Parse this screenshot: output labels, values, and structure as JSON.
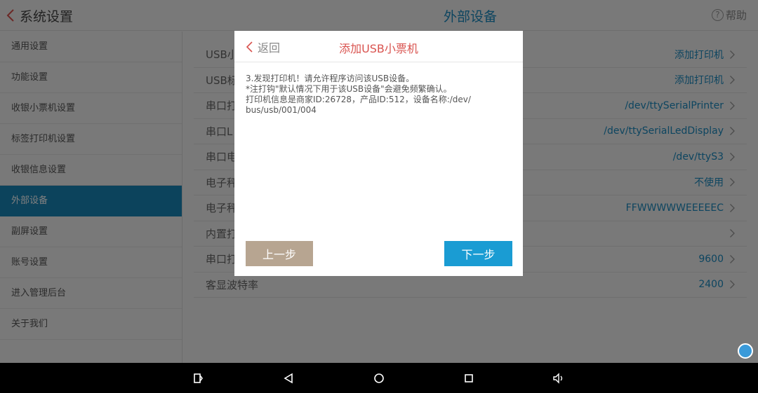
{
  "header": {
    "back_title": "系统设置",
    "page_title": "外部设备",
    "help_label": "帮助",
    "help_glyph": "?"
  },
  "sidebar": {
    "items": [
      {
        "label": "通用设置"
      },
      {
        "label": "功能设置"
      },
      {
        "label": "收银小票机设置"
      },
      {
        "label": "标签打印机设置"
      },
      {
        "label": "收银信息设置"
      },
      {
        "label": "外部设备",
        "active": true
      },
      {
        "label": "副屏设置"
      },
      {
        "label": "账号设置"
      },
      {
        "label": "进入管理后台"
      },
      {
        "label": "关于我们"
      }
    ]
  },
  "settings": {
    "rows": [
      {
        "label": "USB小",
        "value": "添加打印机"
      },
      {
        "label": "USB标",
        "value": "添加打印机"
      },
      {
        "label": "串口打",
        "value": "/dev/ttySerialPrinter"
      },
      {
        "label": "串口L",
        "value": "/dev/ttySerialLedDisplay"
      },
      {
        "label": "串口电",
        "value": "/dev/ttyS3"
      },
      {
        "label": "电子秤",
        "value": "不使用"
      },
      {
        "label": "电子秤",
        "value": "FFWWWWWEEEEEC"
      },
      {
        "label": "内置打",
        "value": ""
      },
      {
        "label": "串口打",
        "value": "9600"
      },
      {
        "label": "客显波特率",
        "value": "2400"
      }
    ]
  },
  "modal": {
    "back_label": "返回",
    "title": "添加USB小票机",
    "lines": [
      "3.发现打印机！请允许程序访问该USB设备。",
      "*注打钩\"默认情况下用于该USB设备\"会避免频繁确认。",
      "打印机信息是商家ID:26728，产品ID:512，设备名称:/dev/",
      "bus/usb/001/004"
    ],
    "prev_label": "上一步",
    "next_label": "下一步"
  },
  "colors": {
    "accent": "#1b8ac0",
    "sidebar_active": "#1986b8",
    "modal_title": "#d9534f",
    "prev_button": "#b7a591",
    "next_button": "#1a9cd3"
  },
  "navbar": {
    "icons": [
      "screenshot-icon",
      "back-icon",
      "home-icon",
      "recents-icon",
      "volume-icon"
    ]
  }
}
